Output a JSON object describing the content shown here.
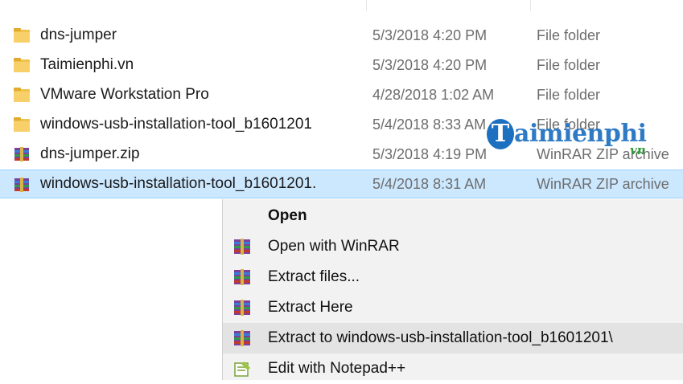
{
  "files": [
    {
      "name": "dns-jumper",
      "date": "5/3/2018 4:20 PM",
      "type": "File folder",
      "icon": "folder-icon",
      "selected": false
    },
    {
      "name": "Taimienphi.vn",
      "date": "5/3/2018 4:20 PM",
      "type": "File folder",
      "icon": "folder-icon",
      "selected": false
    },
    {
      "name": "VMware Workstation Pro",
      "date": "4/28/2018 1:02 AM",
      "type": "File folder",
      "icon": "folder-icon",
      "selected": false
    },
    {
      "name": "windows-usb-installation-tool_b1601201",
      "date": "5/4/2018 8:33 AM",
      "type": "File folder",
      "icon": "folder-icon",
      "selected": false
    },
    {
      "name": "dns-jumper.zip",
      "date": "5/3/2018 4:19 PM",
      "type": "WinRAR ZIP archive",
      "icon": "winrar-icon",
      "selected": false
    },
    {
      "name": "windows-usb-installation-tool_b1601201.",
      "date": "5/4/2018 8:31 AM",
      "type": "WinRAR ZIP archive",
      "icon": "winrar-icon",
      "selected": true
    }
  ],
  "watermark": {
    "letter": "T",
    "text": "aimienphi",
    "suffix": "vn"
  },
  "context_menu": {
    "items": [
      {
        "label": "Open",
        "icon": "",
        "bold": true
      },
      {
        "label": "Open with WinRAR",
        "icon": "winrar-icon"
      },
      {
        "label": "Extract files...",
        "icon": "winrar-icon"
      },
      {
        "label": "Extract Here",
        "icon": "winrar-icon"
      },
      {
        "label": "Extract to windows-usb-installation-tool_b1601201\\",
        "icon": "winrar-icon",
        "hover": true
      },
      {
        "label": "Edit with Notepad++",
        "icon": "notepad-plus-plus-icon"
      }
    ]
  },
  "colors": {
    "selection": "#cce8ff",
    "folder": "#f0c24b",
    "watermark_blue": "#1d6fc0",
    "watermark_green": "#2e9a3a"
  }
}
